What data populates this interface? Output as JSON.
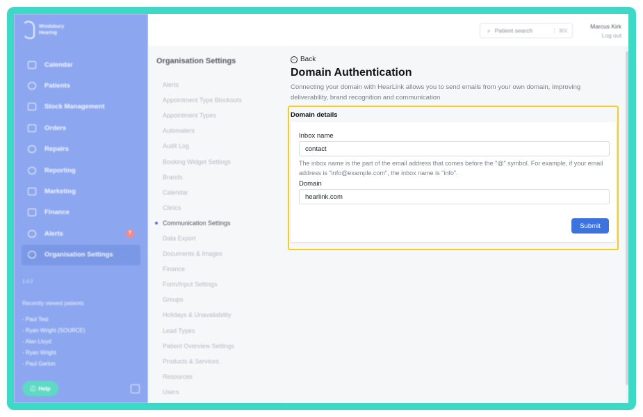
{
  "brand": {
    "name_line1": "Windsbury",
    "name_line2": "Hearing"
  },
  "sidebar": {
    "items": [
      {
        "label": "Calendar",
        "icon": "calendar-icon"
      },
      {
        "label": "Patients",
        "icon": "patients-icon"
      },
      {
        "label": "Stock Management",
        "icon": "stock-icon"
      },
      {
        "label": "Orders",
        "icon": "orders-icon"
      },
      {
        "label": "Repairs",
        "icon": "wrench-icon"
      },
      {
        "label": "Reporting",
        "icon": "chart-icon"
      },
      {
        "label": "Marketing",
        "icon": "mail-icon"
      },
      {
        "label": "Finance",
        "icon": "card-icon"
      },
      {
        "label": "Alerts",
        "icon": "bell-icon",
        "badge": "7"
      },
      {
        "label": "Organisation Settings",
        "icon": "gear-icon",
        "active": true
      }
    ],
    "version": "1.0.2",
    "recent_title": "Recently viewed patients",
    "recent": [
      "- Paul Test",
      "- Ryan Wright (SOURCE)",
      "- Alan Lloyd",
      "- Ryan Wright",
      "- Paul Garton"
    ],
    "help_label": "Help"
  },
  "topbar": {
    "search_placeholder": "Patient search",
    "search_shortcut": "⌘K",
    "user_name": "Marcus Kirk",
    "logout": "Log out"
  },
  "settings": {
    "title": "Organisation Settings",
    "items": [
      "Alerts",
      "Appointment Type Blockouts",
      "Appointment Types",
      "Automaters",
      "Audit Log",
      "Booking Widget Settings",
      "Brands",
      "Calendar",
      "Clinics",
      "Communication Settings",
      "Data Export",
      "Documents & Images",
      "Finance",
      "Form/Input Settings",
      "Groups",
      "Holidays & Unavailability",
      "Lead Types",
      "Patient Overview Settings",
      "Products & Services",
      "Resources",
      "Users"
    ],
    "current": "Communication Settings"
  },
  "main": {
    "back_label": "Back",
    "title": "Domain Authentication",
    "description": "Connecting your domain with HearLink allows you to send emails from your own domain, improving deliverability, brand recognition and communication",
    "card_title": "Domain details",
    "inbox_label": "Inbox name",
    "inbox_value": "contact",
    "inbox_help": "The inbox name is the part of the email address that comes before the \"@\" symbol. For example, if your email address is \"info@example.com\", the inbox name is \"info\".",
    "domain_label": "Domain",
    "domain_value": "hearlink.com",
    "submit_label": "Submit"
  },
  "colors": {
    "frame": "#3ed8c7",
    "sidebar": "#8ca7ef",
    "accent": "#3c73de",
    "highlight": "#f2cd1e"
  }
}
